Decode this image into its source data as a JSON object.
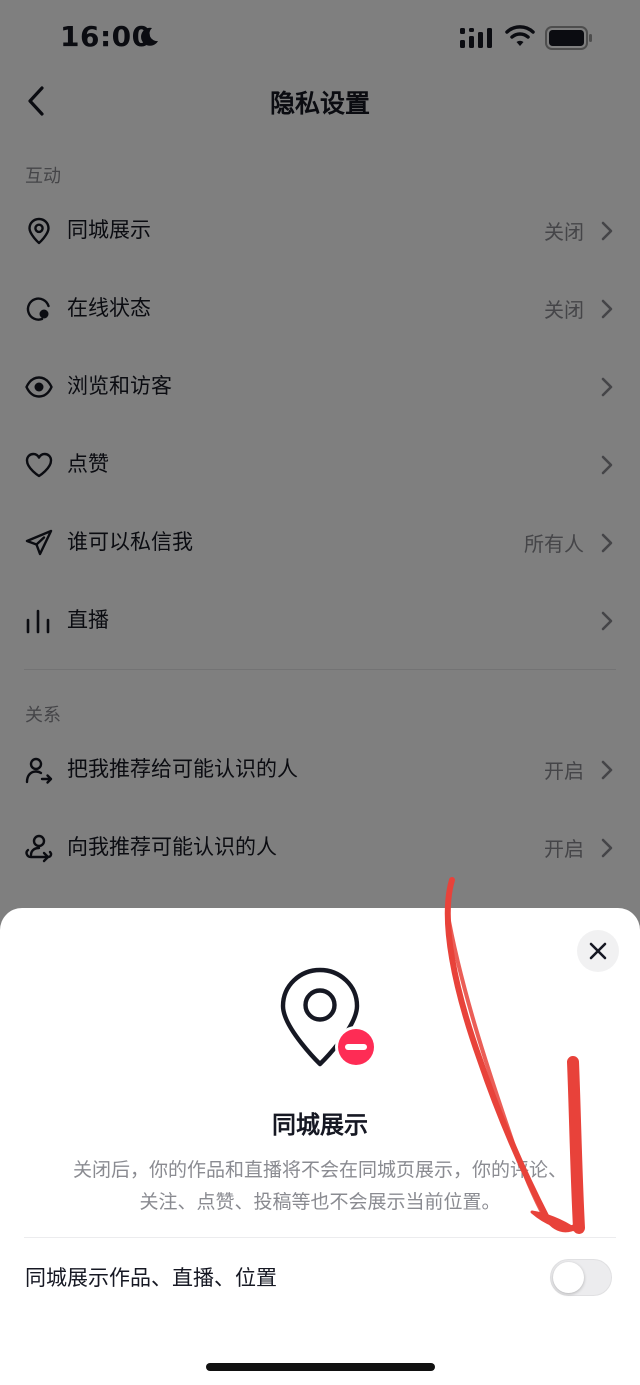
{
  "status_bar": {
    "time": "16:00",
    "icons": [
      "moon-icon",
      "signal-icon",
      "wifi-icon",
      "battery-icon"
    ]
  },
  "header": {
    "title": "隐私设置",
    "back_icon": "chevron-left-icon"
  },
  "sections": [
    {
      "label": "互动",
      "items": [
        {
          "label": "同城展示",
          "value": "关闭",
          "icon": "location-pin-icon"
        },
        {
          "label": "在线状态",
          "value": "关闭",
          "icon": "online-status-icon"
        },
        {
          "label": "浏览和访客",
          "value": "",
          "icon": "eye-icon"
        },
        {
          "label": "点赞",
          "value": "",
          "icon": "heart-icon"
        },
        {
          "label": "谁可以私信我",
          "value": "所有人",
          "icon": "paper-plane-icon"
        },
        {
          "label": "直播",
          "value": "",
          "icon": "live-bars-icon"
        }
      ]
    },
    {
      "label": "关系",
      "items": [
        {
          "label": "把我推荐给可能认识的人",
          "value": "开启",
          "icon": "user-share-icon"
        },
        {
          "label": "向我推荐可能认识的人",
          "value": "开启",
          "icon": "user-recommend-icon"
        }
      ]
    }
  ],
  "sheet": {
    "title": "同城展示",
    "description": "关闭后，你的作品和直播将不会在同城页展示，你的评论、\n关注、点赞、投稿等也不会展示当前位置。",
    "toggle_label": "同城展示作品、直播、位置",
    "toggle_on": false,
    "illustration_icon": "location-off-icon",
    "close_icon": "close-icon"
  },
  "colors": {
    "text_primary": "#161823",
    "text_secondary": "#8a8b91",
    "badge_red": "#fe2c55",
    "annotation_red": "#e8423a"
  }
}
